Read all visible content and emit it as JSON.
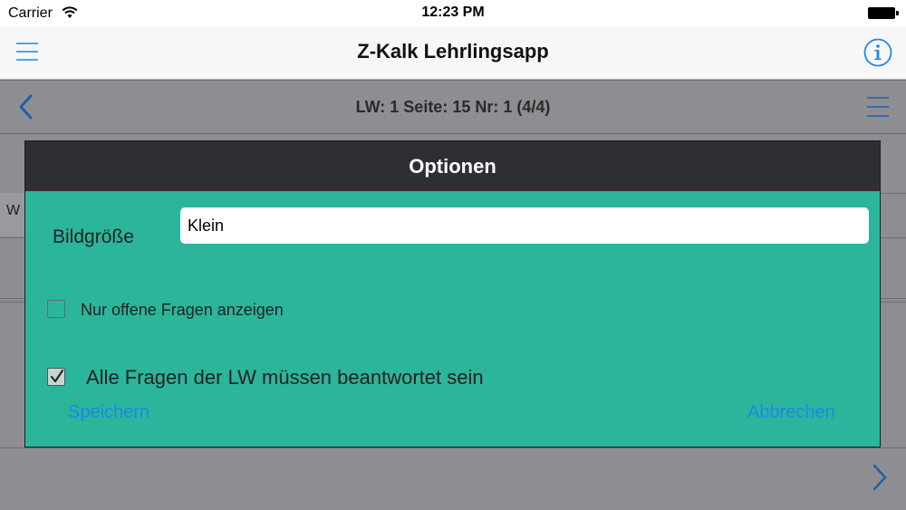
{
  "status_bar": {
    "carrier": "Carrier",
    "time": "12:23 PM",
    "wifi_icon": "wifi-icon",
    "battery_icon": "battery-icon"
  },
  "nav_bar": {
    "title": "Z-Kalk Lehrlingsapp",
    "menu_icon": "hamburger-menu-icon",
    "info_icon": "info-icon"
  },
  "page": {
    "position_label": "LW: 1 Seite: 15 Nr: 1 (4/4)",
    "text_fragment": "W",
    "back_icon": "chevron-left-icon",
    "list_icon": "list-icon",
    "next_icon": "chevron-right-icon"
  },
  "modal": {
    "title": "Optionen",
    "size_label": "Bildgröße",
    "size_value": "Klein",
    "open_questions_label": "Nur offene Fragen anzeigen",
    "open_questions_checked": false,
    "all_answered_label": "Alle Fragen der LW müssen beantwortet sein",
    "all_answered_checked": true,
    "save_label": "Speichern",
    "cancel_label": "Abbrechen"
  },
  "colors": {
    "accent": "#1e88e5",
    "modal_body": "#2bb59b",
    "modal_header": "#2e2e35",
    "dim_background": "#8e8e92"
  }
}
